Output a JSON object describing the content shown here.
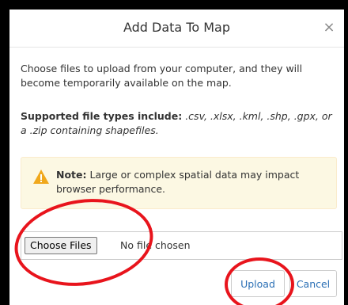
{
  "dialog": {
    "title": "Add Data To Map",
    "close_symbol": "×",
    "intro": "Choose files to upload from your computer, and they will become temporarily available on the map.",
    "supported_label": "Supported file types include:",
    "supported_types": " .csv, .xlsx, .kml, .shp, .gpx, or a .zip containing shapefiles.",
    "note_label": "Note:",
    "note_text": " Large or complex spatial data may impact browser performance.",
    "choose_files_label": "Choose Files",
    "no_file_text": "No file chosen",
    "upload_label": "Upload",
    "cancel_label": "Cancel"
  },
  "icons": {
    "warning": "warning-triangle-icon",
    "close": "close-icon"
  },
  "colors": {
    "accent": "#2a6fb5",
    "warning_icon": "#f0a81c",
    "alert_bg": "#fcf8e3",
    "annotation": "#e8141c"
  }
}
